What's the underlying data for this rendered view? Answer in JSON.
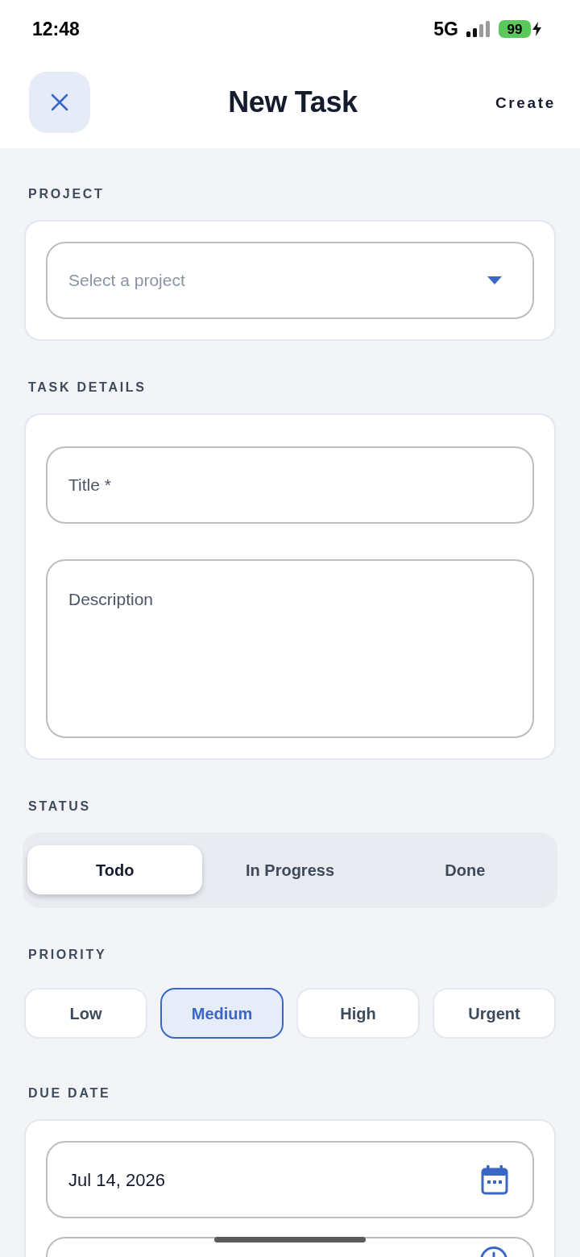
{
  "status_bar": {
    "time": "12:48",
    "network": "5G",
    "battery": "99",
    "charging": true
  },
  "header": {
    "title": "New Task",
    "action": "Create"
  },
  "sections": [
    {
      "label": "PROJECT",
      "kind": "picker",
      "fields": [
        {
          "kind": "dropdown",
          "placeholder": "Select a project"
        }
      ]
    },
    {
      "label": "TASK DETAILS",
      "kind": "details",
      "fields": [
        {
          "kind": "text",
          "placeholder": "Title *"
        },
        {
          "kind": "textarea",
          "placeholder": "Description"
        }
      ]
    },
    {
      "label": "STATUS",
      "kind": "segmented",
      "options": [
        {
          "label": "Todo",
          "selected": true
        },
        {
          "label": "In Progress",
          "selected": false
        },
        {
          "label": "Done",
          "selected": false
        }
      ]
    },
    {
      "label": "PRIORITY",
      "kind": "chips",
      "options": [
        {
          "label": "Low",
          "selected": false
        },
        {
          "label": "Medium",
          "selected": true
        },
        {
          "label": "High",
          "selected": false
        },
        {
          "label": "Urgent",
          "selected": false
        }
      ]
    },
    {
      "label": "DUE DATE",
      "kind": "picker",
      "fields": [
        {
          "kind": "date",
          "value": "Jul 14, 2026"
        },
        {
          "kind": "time"
        }
      ]
    }
  ]
}
